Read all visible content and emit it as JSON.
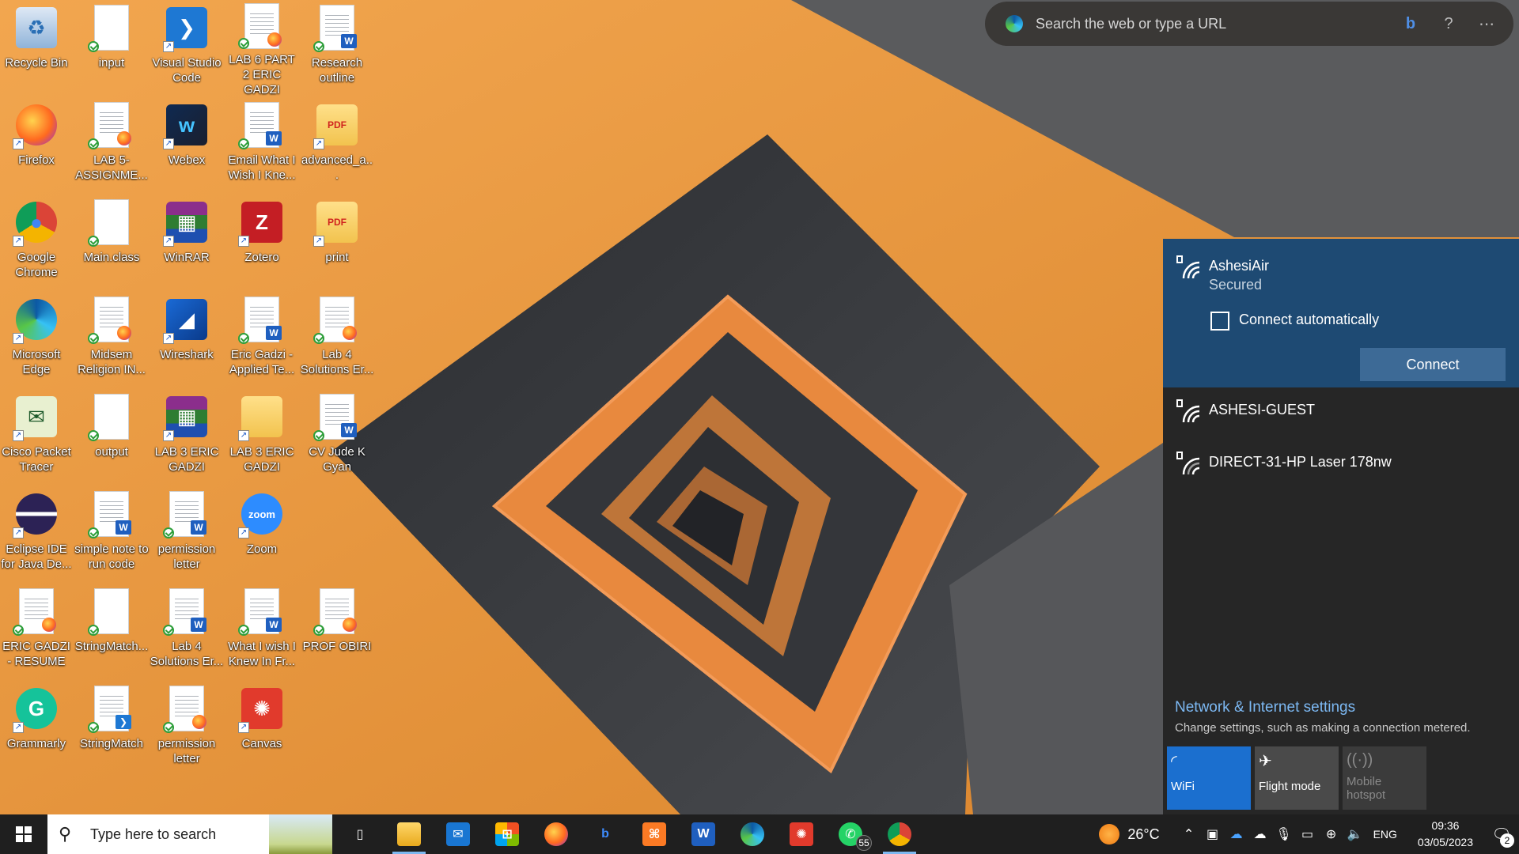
{
  "desktop": {
    "icons": [
      {
        "label": "Recycle Bin",
        "icon": "recycle-bin-icon"
      },
      {
        "label": "input",
        "icon": "file-icon"
      },
      {
        "label": "Visual Studio Code",
        "icon": "vscode-icon"
      },
      {
        "label": "LAB 6 PART 2 ERIC GADZI",
        "icon": "pdf-doc-icon"
      },
      {
        "label": "Research outline",
        "icon": "word-doc-icon"
      },
      {
        "label": "Firefox",
        "icon": "firefox-icon"
      },
      {
        "label": "LAB 5-ASSIGNME...",
        "icon": "pdf-doc-icon"
      },
      {
        "label": "Webex",
        "icon": "webex-icon"
      },
      {
        "label": "Email What I Wish I Kne...",
        "icon": "word-doc-icon"
      },
      {
        "label": "advanced_a...",
        "icon": "pdf-folder-icon"
      },
      {
        "label": "Google Chrome",
        "icon": "chrome-icon"
      },
      {
        "label": "Main.class",
        "icon": "file-icon"
      },
      {
        "label": "WinRAR",
        "icon": "winrar-icon"
      },
      {
        "label": "Zotero",
        "icon": "zotero-icon"
      },
      {
        "label": "print",
        "icon": "pdf-folder-icon"
      },
      {
        "label": "Microsoft Edge",
        "icon": "edge-icon"
      },
      {
        "label": "Midsem Religion IN...",
        "icon": "pdf-doc-icon"
      },
      {
        "label": "Wireshark",
        "icon": "wireshark-icon"
      },
      {
        "label": "Eric Gadzi - Applied Te...",
        "icon": "word-doc-icon"
      },
      {
        "label": "Lab 4 Solutions Er...",
        "icon": "pdf-doc-icon"
      },
      {
        "label": "Cisco Packet Tracer",
        "icon": "packet-tracer-icon"
      },
      {
        "label": "output",
        "icon": "file-icon"
      },
      {
        "label": "LAB 3 ERIC GADZI",
        "icon": "winrar-icon"
      },
      {
        "label": "LAB 3 ERIC GADZI",
        "icon": "folder-icon"
      },
      {
        "label": "CV Jude K Gyan",
        "icon": "word-doc-icon"
      },
      {
        "label": "Eclipse IDE for Java De...",
        "icon": "eclipse-icon"
      },
      {
        "label": "simple note to run code",
        "icon": "word-doc-icon"
      },
      {
        "label": "permission letter",
        "icon": "word-doc-icon"
      },
      {
        "label": "Zoom",
        "icon": "zoom-icon"
      },
      {
        "label": "",
        "icon": ""
      },
      {
        "label": "ERIC GADZI - RESUME",
        "icon": "pdf-doc-icon"
      },
      {
        "label": "StringMatch...",
        "icon": "file-icon"
      },
      {
        "label": "Lab 4 Solutions Er...",
        "icon": "word-doc-icon"
      },
      {
        "label": "What I wish I Knew In Fr...",
        "icon": "word-doc-icon"
      },
      {
        "label": "PROF OBIRI",
        "icon": "pdf-doc-icon"
      },
      {
        "label": "Grammarly",
        "icon": "grammarly-icon"
      },
      {
        "label": "StringMatch",
        "icon": "vscode-doc-icon"
      },
      {
        "label": "permission letter",
        "icon": "pdf-doc-icon"
      },
      {
        "label": "Canvas",
        "icon": "canvas-icon"
      }
    ]
  },
  "browser_search": {
    "placeholder": "Search the web or type a URL",
    "icons": [
      "edge-icon",
      "bing-icon",
      "help-icon",
      "more-icon"
    ]
  },
  "network_flyout": {
    "active_network": {
      "name": "AshesiAir",
      "status": "Secured",
      "auto_connect_label": "Connect automatically",
      "auto_connect_checked": false,
      "connect_label": "Connect"
    },
    "networks": [
      {
        "name": "ASHESI-GUEST"
      },
      {
        "name": "DIRECT-31-HP Laser 178nw"
      }
    ],
    "settings_link": "Network & Internet settings",
    "settings_desc": "Change settings, such as making a connection metered.",
    "tiles": [
      {
        "label": "WiFi",
        "state": "on",
        "icon": "wifi-icon"
      },
      {
        "label": "Flight mode",
        "state": "off",
        "icon": "airplane-icon"
      },
      {
        "label": "Mobile hotspot",
        "state": "disabled",
        "icon": "hotspot-icon"
      }
    ]
  },
  "taskbar": {
    "search_placeholder": "Type here to search",
    "apps": [
      {
        "name": "task-view",
        "glyph": "▯"
      },
      {
        "name": "file-explorer",
        "glyph": ""
      },
      {
        "name": "mail",
        "glyph": "✉"
      },
      {
        "name": "microsoft-store",
        "glyph": "⊞"
      },
      {
        "name": "firefox",
        "glyph": ""
      },
      {
        "name": "bing",
        "glyph": "b"
      },
      {
        "name": "xampp",
        "glyph": "⌘"
      },
      {
        "name": "word",
        "glyph": "W"
      },
      {
        "name": "edge",
        "glyph": ""
      },
      {
        "name": "canvas",
        "glyph": "✺"
      },
      {
        "name": "whatsapp",
        "glyph": "✆",
        "badge": "55"
      },
      {
        "name": "chrome",
        "glyph": ""
      }
    ],
    "weather": {
      "temp": "26°C"
    },
    "language": "ENG",
    "time": "09:36",
    "date": "03/05/2023",
    "notification_count": "2"
  }
}
